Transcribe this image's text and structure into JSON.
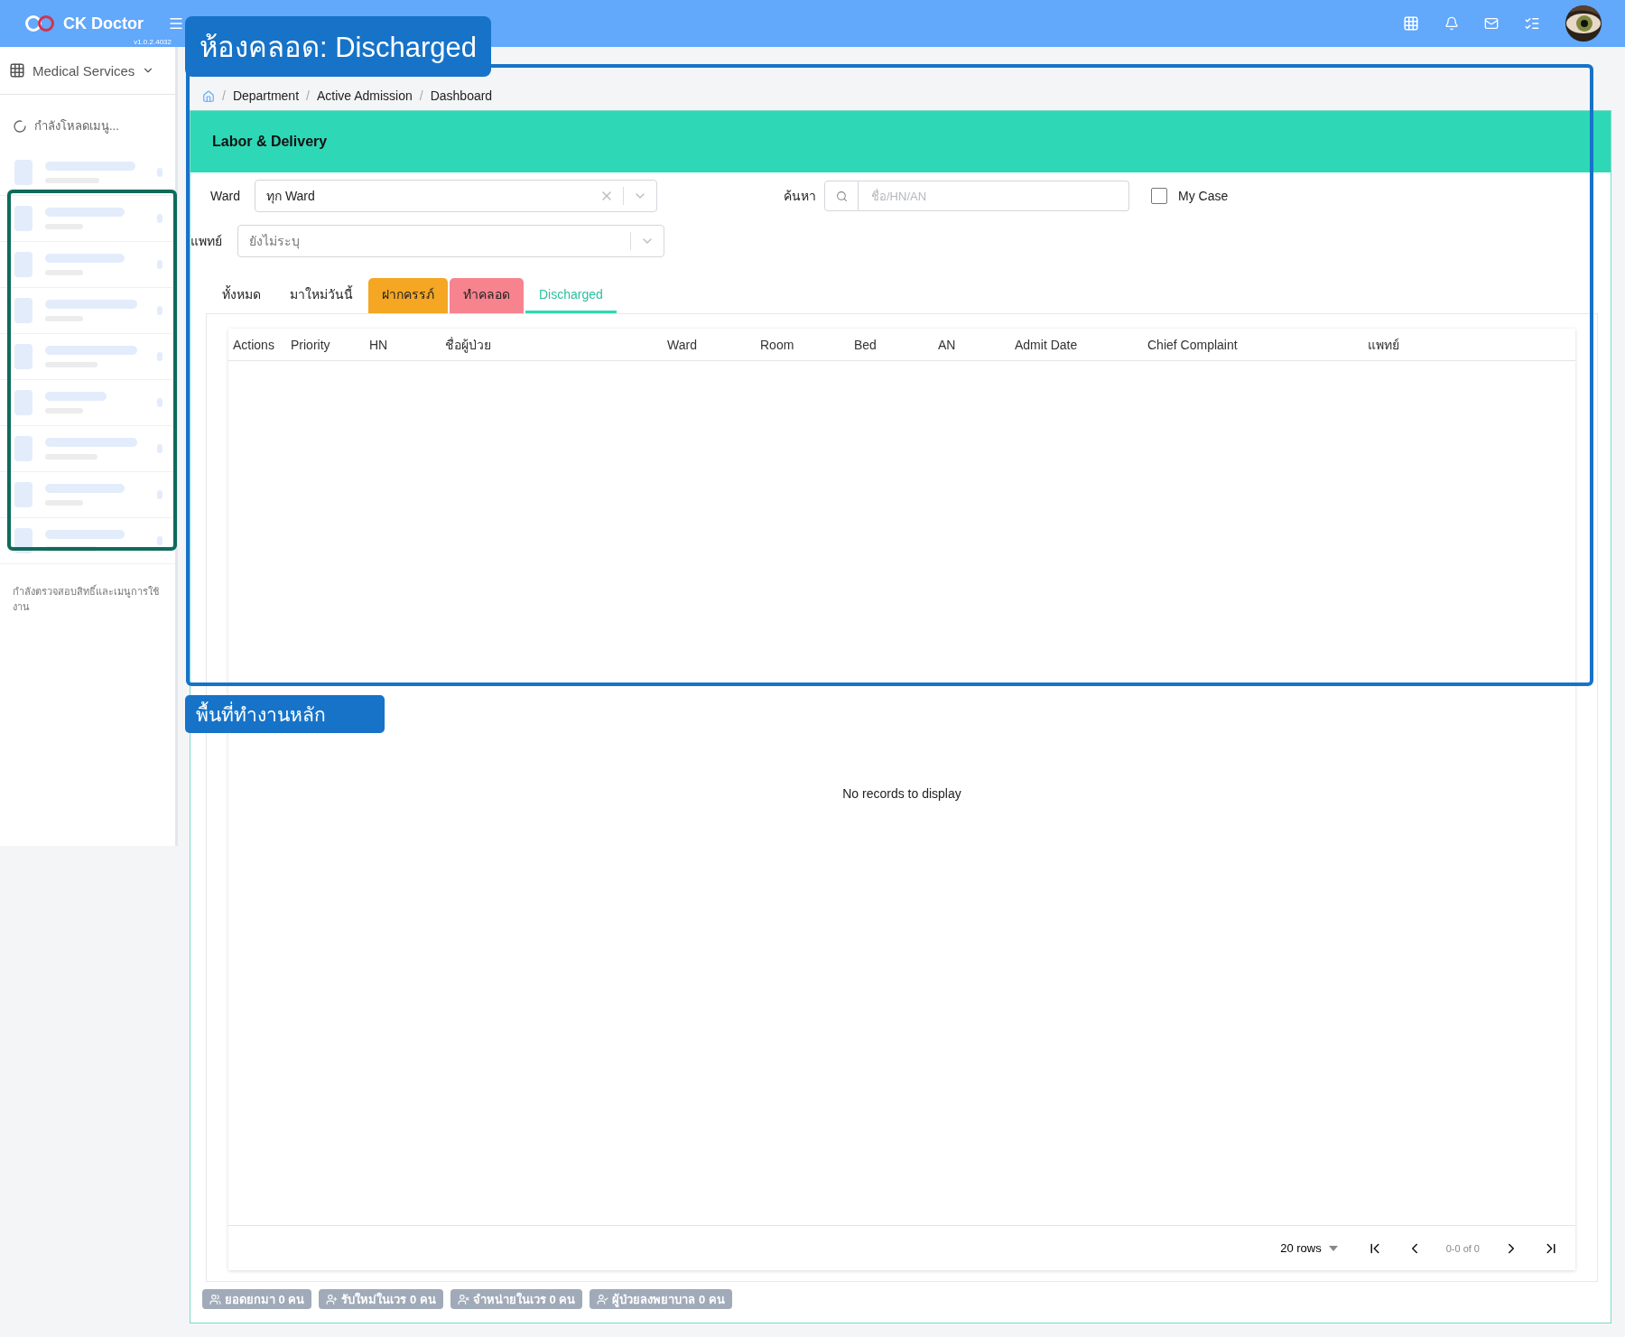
{
  "app": {
    "name": "CK Doctor",
    "version": "v1.0.2.4032"
  },
  "module_menu": {
    "label": "Medical Services"
  },
  "sidebar": {
    "loading_text": "กำลังโหลดเมนู...",
    "placeholder_rows": [
      {
        "kind": "skeleton"
      },
      {
        "kind": "skeleton"
      },
      {
        "kind": "skeleton"
      },
      {
        "kind": "skeleton"
      },
      {
        "kind": "skeleton"
      },
      {
        "kind": "skeleton"
      },
      {
        "kind": "skeleton"
      },
      {
        "kind": "skeleton"
      },
      {
        "kind": "skeleton"
      }
    ],
    "status_text": "กำลังตรวจสอบสิทธิ์และเมนูการใช้งาน"
  },
  "breadcrumb": [
    {
      "kind": "separator",
      "text": "/"
    },
    {
      "kind": "link",
      "text": "Department"
    },
    {
      "kind": "separator",
      "text": "/"
    },
    {
      "kind": "link",
      "text": "Active Admission"
    },
    {
      "kind": "separator",
      "text": "/"
    },
    {
      "kind": "link",
      "text": "Dashboard"
    }
  ],
  "banner": {
    "title": "Labor & Delivery"
  },
  "filters": {
    "ward": {
      "label": "Ward",
      "value": "ทุก Ward"
    },
    "search": {
      "label": "ค้นหา",
      "placeholder": "ชื่อ/HN/AN"
    },
    "my_case": {
      "label": "My Case",
      "checked": false
    },
    "doctor": {
      "label": "แพทย์",
      "placeholder": "ยังไม่ระบุ"
    }
  },
  "tabs": [
    {
      "label": "ทั้งหมด",
      "selected": false
    },
    {
      "label": "มาใหม่วันนี้",
      "selected": false
    },
    {
      "label": "ฝากครรภ์",
      "selected": false,
      "color": "#f5a623"
    },
    {
      "label": "ทำคลอด",
      "selected": false,
      "color": "#f7838f"
    },
    {
      "label": "Discharged",
      "selected": true
    }
  ],
  "table": {
    "columns": [
      "Actions",
      "Priority",
      "HN",
      "ชื่อผู้ป่วย",
      "Ward",
      "Room",
      "Bed",
      "AN",
      "Admit Date",
      "Chief Complaint",
      "แพทย์"
    ],
    "empty_text": "No records to display"
  },
  "pagination": {
    "rows": "20 rows",
    "range": "0-0 of 0"
  },
  "summary_chips": [
    {
      "kind": "people",
      "label": "ยอดยกมา 0 คน"
    },
    {
      "kind": "add",
      "label": "รับใหม่ในเวร 0 คน"
    },
    {
      "kind": "remove",
      "label": "จำหน่ายในเวร 0 คน"
    },
    {
      "kind": "check",
      "label": "ผู้ป่วยลงพยาบาล 0 คน"
    }
  ],
  "annotations": [
    {
      "kind": "callout",
      "text": "ห้องคลอด: Discharged"
    },
    {
      "kind": "label",
      "text": "พื้นที่ทำงานหลัก"
    }
  ]
}
